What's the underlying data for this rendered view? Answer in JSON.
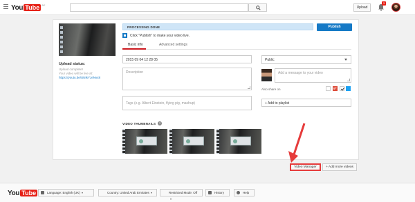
{
  "header": {
    "logo_you": "You",
    "logo_tube": "Tube",
    "logo_region": "AE",
    "upload_label": "Upload",
    "notification_count": "3"
  },
  "upload": {
    "status_title": "Upload status:",
    "status_line1": "Upload complete!",
    "status_line2": "Your video will be live at:",
    "video_link": "https://youtu.be/UNIkYJeNvx8"
  },
  "processing": {
    "status": "PROCESSING DONE",
    "publish_label": "Publish",
    "hint": "Click \"Publish\" to make your video live."
  },
  "tabs": [
    {
      "label": "Basic info"
    },
    {
      "label": "Advanced settings"
    }
  ],
  "form": {
    "title_value": "2015 09 04 12 28 05",
    "description_placeholder": "Description",
    "tags_placeholder": "Tags (e.g. Albert Einstein, flying pig, mashup)",
    "privacy_value": "Public",
    "message_placeholder": "Add a message to your video",
    "share_label": "Also share on",
    "playlist_label": "+ Add to playlist"
  },
  "thumbnails": {
    "title": "VIDEO THUMBNAILS",
    "help": "?"
  },
  "actions": {
    "video_manager": "Video Manager",
    "add_more": "+ Add more videos"
  },
  "footer": {
    "language": "Language: English (UK)",
    "country": "Country: United Arab Emirates",
    "restricted": "Restricted Mode: Off",
    "history": "History",
    "help": "Help"
  },
  "colors": {
    "accent": "#167ac6",
    "brand_red": "#e62117",
    "highlight": "#e63b3b"
  }
}
